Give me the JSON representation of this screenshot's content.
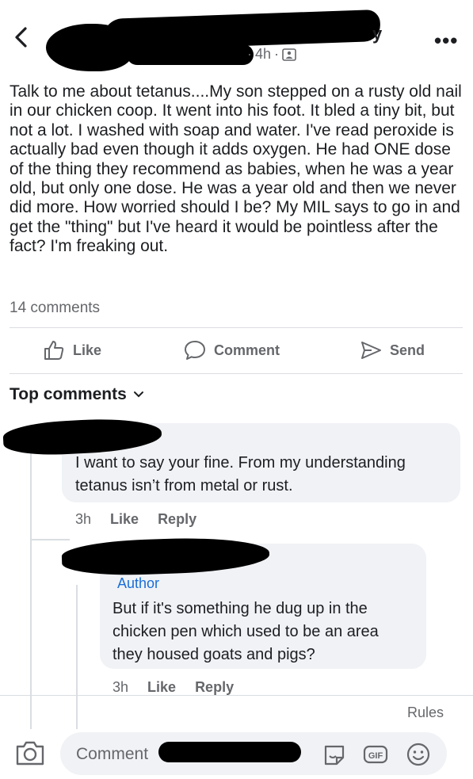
{
  "header": {
    "name_tail": "y",
    "time": "4h",
    "sep": "·",
    "more_label": "•••"
  },
  "post": {
    "text": "Talk to me about tetanus....My son stepped on a rusty old nail in our chicken coop. It went into his foot. It bled a tiny bit, but not a lot. I washed with soap and water. I've read peroxide is actually bad even though it adds oxygen. He had ONE dose of the thing they recommend as babies, when he was a year old, but only one dose. He was a year old and then we never did more. How worried should I be? My MIL says to go in and get the \"thing\" but I've heard it would be pointless after the fact? I'm freaking out.",
    "comment_count": "14 comments"
  },
  "actions": {
    "like": "Like",
    "comment": "Comment",
    "send": "Send"
  },
  "comments_section": {
    "title": "Top comments"
  },
  "comments": [
    {
      "text_lines": [
        "I want to say your fine. From my understanding",
        "tetanus isn’t from metal or rust."
      ],
      "time": "3h",
      "like": "Like",
      "reply": "Reply"
    },
    {
      "badge": "Author",
      "text_lines": [
        "But if it's something he dug up in the",
        "chicken pen which used to be an area",
        "they housed goats and pigs?"
      ],
      "time": "3h",
      "like": "Like",
      "reply": "Reply"
    }
  ],
  "footer": {
    "rules": "Rules",
    "input_placeholder": "Comment",
    "gif_label": "GIF"
  },
  "icons": {
    "back": "chevron-left-icon",
    "more": "more-icon",
    "like": "thumbs-up-icon",
    "comment": "speech-bubble-icon",
    "send": "send-arrow-icon",
    "camera": "camera-icon",
    "sticker": "sticker-icon",
    "gif": "gif-icon",
    "emoji": "emoji-icon"
  },
  "colors": {
    "text": "#1c1e21",
    "muted": "#65676b",
    "bubble": "#f0f2f5",
    "author": "#1a6ed8"
  }
}
